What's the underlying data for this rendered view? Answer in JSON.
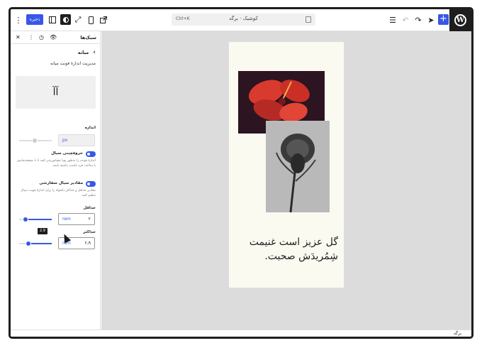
{
  "toolbar": {
    "save_label": "ذخیره",
    "command_title": "کوشیک · برگه",
    "command_shortcut": "Ctrl+K",
    "add_label": "+"
  },
  "sidebar": {
    "title": "سبک‌ها",
    "back_label": "میانه",
    "description": "مدیریت اندازهٔ فونت میانه",
    "preview_text": "آآ",
    "size_label": "اندازه",
    "size_placeholder": "px",
    "fluid_label": "حروفچینی سیال",
    "fluid_help": "اندازهٔ فونت را به‌طور پویا مقیاس‌پذیر کنید تا با صفحه‌نمایش یا ساخت فرد تناسب داشته باشد.",
    "custom_label": "مقادیر سیال سفارشی",
    "custom_help": "مقادیر حداقل و حداکثر دلخواه را برای اندازهٔ فونت سیال تنظیم کنید.",
    "min_label": "حداقل",
    "min_value": "۲",
    "min_unit": "rem",
    "min_fraction": 0.2,
    "max_label": "حداکثر",
    "max_value": "۲٫۹",
    "max_unit": "rem",
    "max_fraction": 0.29,
    "tooltip": "2.9"
  },
  "canvas": {
    "quote_line1": "گل عزیز است غنیمت",
    "quote_line2": "شِمُریدَش صحبت."
  },
  "footer": {
    "breadcrumb": "برگه"
  },
  "colors": {
    "accent": "#3858e9",
    "dark": "#1e1e1e",
    "canvas": "#dcdcdc",
    "page": "#fbfaf1"
  }
}
